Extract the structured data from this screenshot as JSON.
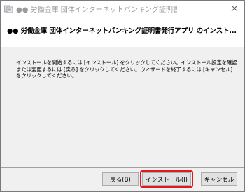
{
  "window": {
    "title": "●● 労働金庫 団体インターネットバンキング証明書発行アプリ セ...",
    "controls": {
      "close_icon": "close-icon"
    }
  },
  "header": {
    "title": "●● 労働金庫 団体インターネットバンキング証明書発行アプリ のインスト..."
  },
  "body": {
    "instructions": "インストールを開始するには [インストール] をクリックしてください。インストール設定を確認または変更するには [戻る] をクリックしてください。ウィザードを終了するには [キャンセル] をクリックしてください。"
  },
  "buttons": {
    "back": "戻る(B)",
    "install": "インストール(I)",
    "cancel": "キャンセル"
  },
  "colors": {
    "highlight": "#e0191f",
    "title_inactive": "#9a9a9a"
  }
}
